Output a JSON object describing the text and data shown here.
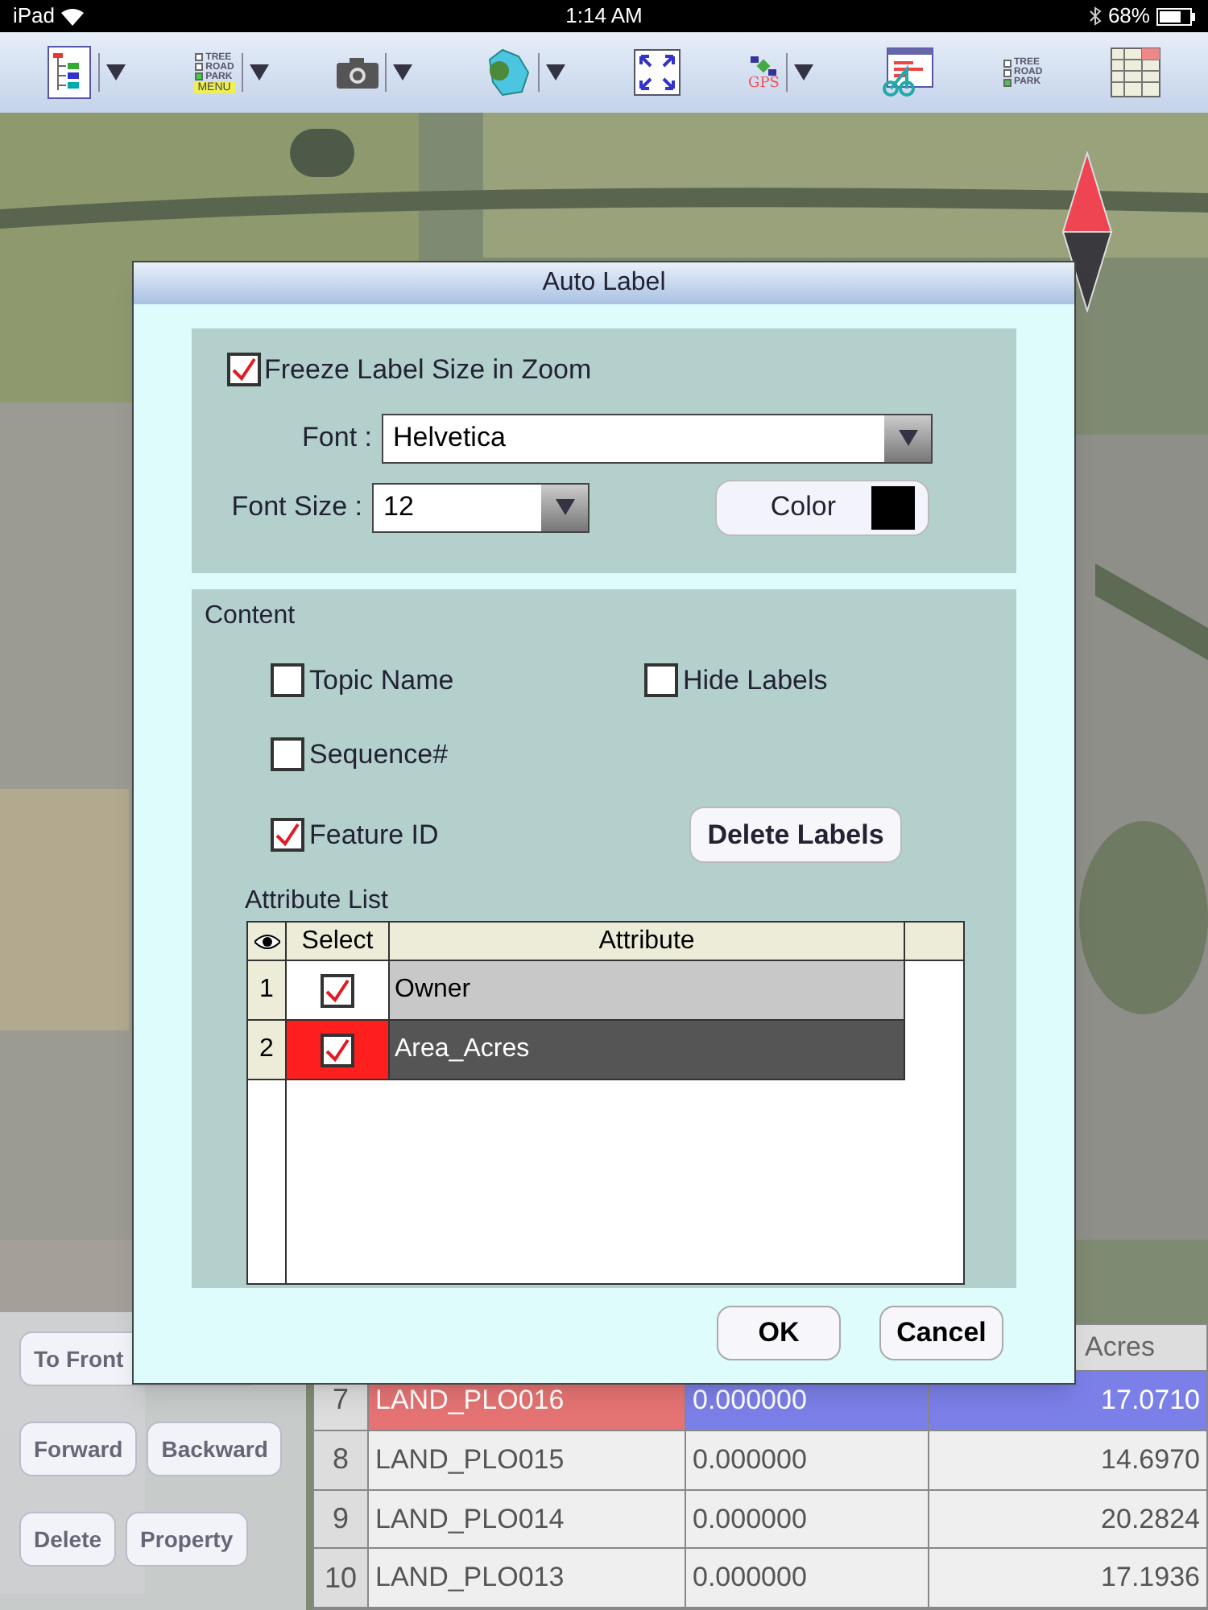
{
  "status_bar": {
    "device": "iPad",
    "time": "1:14 AM",
    "battery": "68%"
  },
  "toolbar": [
    {
      "kind": "layers",
      "dropdown": true
    },
    {
      "kind": "legend-menu",
      "dropdown": true,
      "legend": [
        "TREE",
        "ROAD",
        "PARK"
      ],
      "label": "MENU"
    },
    {
      "kind": "camera",
      "dropdown": true
    },
    {
      "kind": "region",
      "dropdown": true
    },
    {
      "kind": "extent",
      "dropdown": false
    },
    {
      "kind": "gps",
      "dropdown": true,
      "label": "GPS"
    },
    {
      "kind": "chart",
      "dropdown": false
    },
    {
      "kind": "legend",
      "dropdown": false,
      "legend": [
        "TREE",
        "ROAD",
        "PARK"
      ]
    },
    {
      "kind": "grid",
      "dropdown": false
    }
  ],
  "map": {
    "kind": "picture"
  },
  "side_buttons": [
    [
      "To Front"
    ],
    [
      "Forward",
      "Backward"
    ],
    [
      "Delete",
      "Property"
    ]
  ],
  "table": {
    "header_last": "Acres",
    "rows": [
      {
        "num": "7",
        "name": "LAND_PLO016",
        "value": "0.000000",
        "acres": "17.0710",
        "selected": true
      },
      {
        "num": "8",
        "name": "LAND_PLO015",
        "value": "0.000000",
        "acres": "14.6970",
        "selected": false
      },
      {
        "num": "9",
        "name": "LAND_PLO014",
        "value": "0.000000",
        "acres": "20.2824",
        "selected": false
      },
      {
        "num": "10",
        "name": "LAND_PLO013",
        "value": "0.000000",
        "acres": "17.1936",
        "selected": false
      }
    ]
  },
  "dialog": {
    "title": "Auto Label",
    "freeze": {
      "label": "Freeze Label Size in Zoom",
      "checked": true
    },
    "font": {
      "label": "Font :",
      "value": "Helvetica"
    },
    "font_size": {
      "label": "Font Size :",
      "value": "12"
    },
    "color_button": {
      "label": "Color",
      "color": "#000000"
    },
    "content_title": "Content",
    "options": [
      {
        "label": "Topic Name",
        "checked": false
      },
      {
        "label": "Hide Labels",
        "checked": false
      },
      {
        "label": "Sequence#",
        "checked": false
      },
      {
        "label": "Feature ID",
        "checked": true
      }
    ],
    "delete_button": "Delete Labels",
    "attribute_title": "Attribute List",
    "columns": [
      "Select",
      "Attribute"
    ],
    "attributes": [
      {
        "num": "1",
        "name": "Owner",
        "checked": true,
        "selected": false
      },
      {
        "num": "2",
        "name": "Area_Acres",
        "checked": true,
        "selected": true
      }
    ],
    "buttons": [
      "OK",
      "Cancel"
    ]
  }
}
